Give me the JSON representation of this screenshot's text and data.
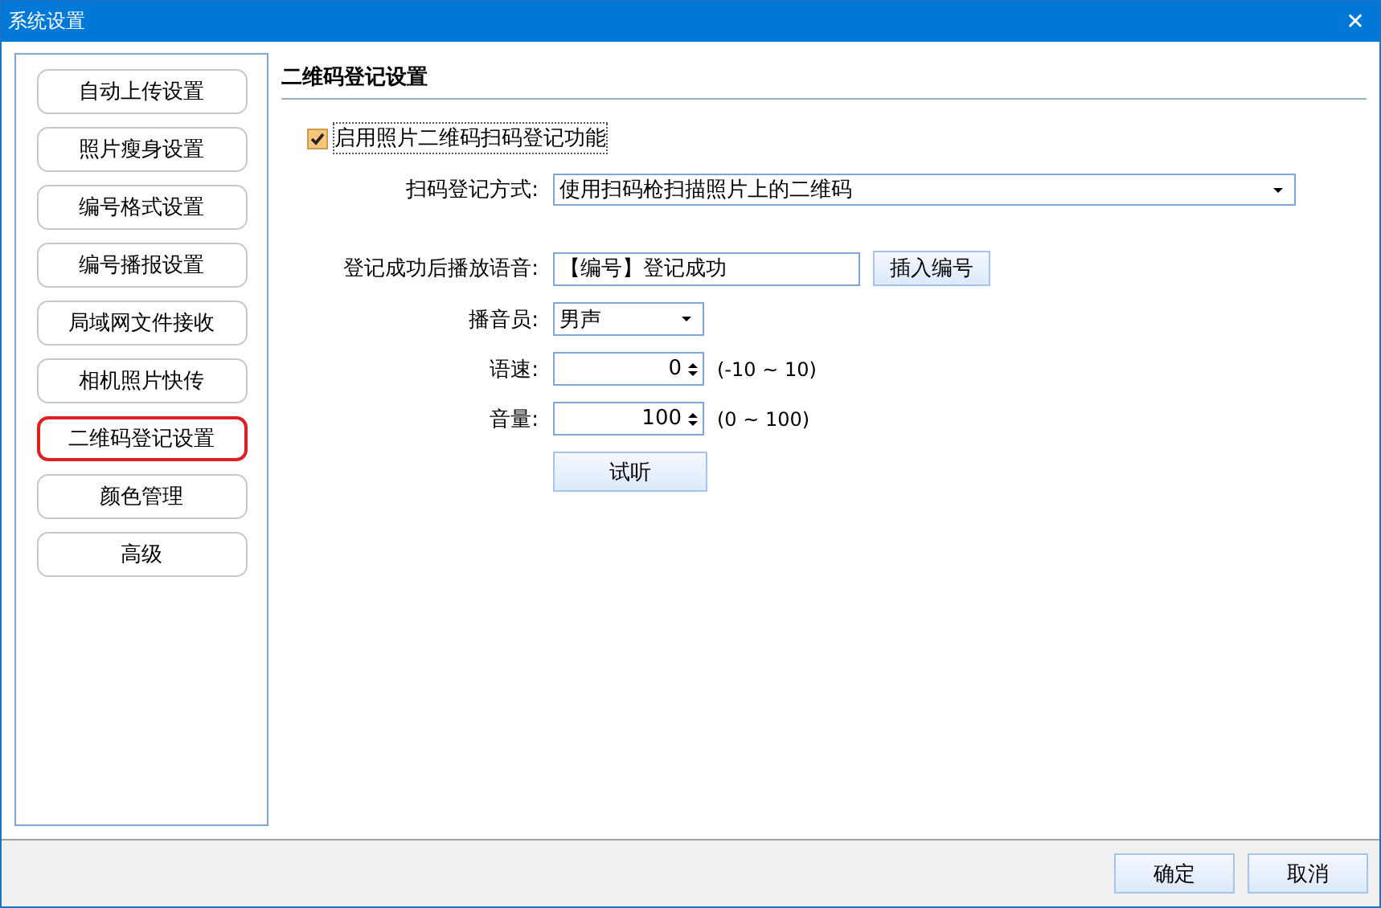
{
  "window": {
    "title": "系统设置",
    "close": "✕"
  },
  "sidebar": {
    "items": [
      {
        "label": "自动上传设置",
        "selected": false
      },
      {
        "label": "照片瘦身设置",
        "selected": false
      },
      {
        "label": "编号格式设置",
        "selected": false
      },
      {
        "label": "编号播报设置",
        "selected": false
      },
      {
        "label": "局域网文件接收",
        "selected": false
      },
      {
        "label": "相机照片快传",
        "selected": false
      },
      {
        "label": "二维码登记设置",
        "selected": true
      },
      {
        "label": "颜色管理",
        "selected": false
      },
      {
        "label": "高级",
        "selected": false
      }
    ]
  },
  "section": {
    "title": "二维码登记设置",
    "enable": {
      "label": "启用照片二维码扫码登记功能",
      "checked": true
    },
    "scan_mode": {
      "label": "扫码登记方式:",
      "value": "使用扫码枪扫描照片上的二维码"
    },
    "voice": {
      "label": "登记成功后播放语音:",
      "value": "【编号】登记成功",
      "button": "插入编号"
    },
    "announcer": {
      "label": "播音员:",
      "value": "男声"
    },
    "speed": {
      "label": "语速:",
      "value": "0",
      "range": "(-10 ~ 10)"
    },
    "volume": {
      "label": "音量:",
      "value": "100",
      "range": "(0 ~ 100)"
    },
    "test_button": "试听"
  },
  "buttons": [
    "确定",
    "取消"
  ]
}
